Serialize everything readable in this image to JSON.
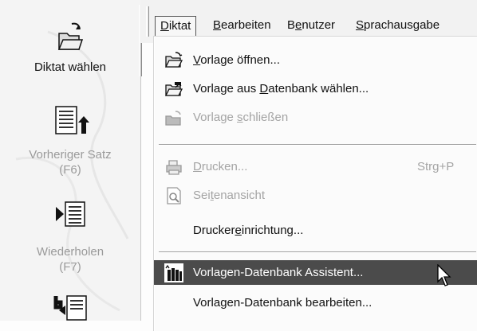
{
  "toolbar": {
    "items": [
      {
        "label": "Diktat wählen",
        "icon": "folder-open-icon",
        "enabled": true
      },
      {
        "label": "Vorheriger Satz",
        "sublabel": "(F6)",
        "icon": "previous-sentence-icon",
        "enabled": false
      },
      {
        "label": "Wiederholen",
        "sublabel": "(F7)",
        "icon": "repeat-icon",
        "enabled": false
      }
    ]
  },
  "menubar": {
    "items": [
      {
        "label_pre": "",
        "label_ul": "D",
        "label_post": "iktat"
      },
      {
        "label_pre": "",
        "label_ul": "B",
        "label_post": "earbeiten"
      },
      {
        "label_pre": "B",
        "label_ul": "e",
        "label_post": "nutzer"
      },
      {
        "label_pre": "",
        "label_ul": "S",
        "label_post": "prachausgabe"
      }
    ]
  },
  "dropdown": {
    "items": [
      {
        "pre": "",
        "ul": "V",
        "post": "orlage öffnen...",
        "shortcut": "",
        "enabled": true,
        "icon": "open-folder-icon"
      },
      {
        "pre": "Vorlage aus ",
        "ul": "D",
        "post": "atenbank wählen...",
        "shortcut": "",
        "enabled": true,
        "icon": "database-folder-icon"
      },
      {
        "pre": "Vorlage ",
        "ul": "s",
        "post": "chließen",
        "shortcut": "",
        "enabled": false,
        "icon": "close-folder-icon"
      },
      {
        "pre": "",
        "ul": "D",
        "post": "rucken...",
        "shortcut": "Strg+P",
        "enabled": false,
        "icon": "printer-icon"
      },
      {
        "pre": "Sei",
        "ul": "t",
        "post": "enansicht",
        "shortcut": "",
        "enabled": false,
        "icon": "page-preview-icon"
      },
      {
        "pre": "Drucker",
        "ul": "e",
        "post": "inrichtung...",
        "shortcut": "",
        "enabled": true,
        "icon": ""
      },
      {
        "pre": "Vorlagen-Datenbank Assistent...",
        "ul": "",
        "post": "",
        "shortcut": "",
        "enabled": true,
        "highlight": true,
        "icon": "books-wizard-icon"
      },
      {
        "pre": "Vorlagen-Datenbank bearbeiten...",
        "ul": "",
        "post": "",
        "shortcut": "",
        "enabled": true,
        "icon": ""
      }
    ]
  },
  "colors": {
    "highlight_bg": "#4b4b4b",
    "disabled_text": "#a4a4a4"
  }
}
